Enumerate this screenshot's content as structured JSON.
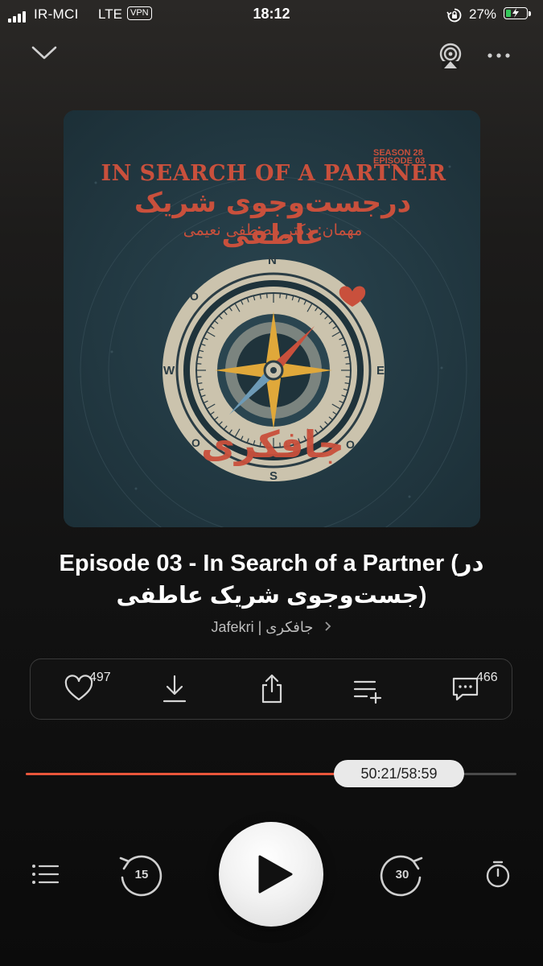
{
  "status_bar": {
    "carrier": "IR-MCI",
    "network": "LTE",
    "vpn": "VPN",
    "time": "18:12",
    "battery_percent": "27%",
    "battery_level": 0.27
  },
  "top_bar": {
    "collapse_icon": "chevron-down-icon",
    "airplay_icon": "airplay-icon",
    "more_icon": "more-horizontal-icon"
  },
  "artwork": {
    "season": "SEASON 28",
    "episode": "EPISODE 03",
    "headline": "IN SEARCH OF A PARTNER",
    "persian_title": "درجست‌وجوی شریک عاطفی",
    "guest": "مهمان: دکتر مصطفی نعیمی",
    "brand": "جافکری",
    "compass": {
      "n": "N",
      "s": "S",
      "e": "E",
      "w": "W",
      "o": "O"
    },
    "colors": {
      "background": "#21363f",
      "accent": "#c9503c",
      "dial": "#cbc3ad"
    }
  },
  "episode": {
    "title": "Episode 03 - In Search of a Partner (در جست‌وجوی شریک عاطفی)",
    "podcast": "Jafekri | جافکری"
  },
  "actions": {
    "like_count": "497",
    "comment_count": "466",
    "icons": [
      "heart-icon",
      "download-icon",
      "share-icon",
      "add-to-queue-icon",
      "comment-icon"
    ]
  },
  "progress": {
    "elapsed_total": "50:21/58:59",
    "fraction": 0.853,
    "played_color": "#e8553a"
  },
  "controls": {
    "rewind_seconds": "15",
    "forward_seconds": "30",
    "play_icon": "play-icon",
    "queue_icon": "queue-list-icon",
    "timer_icon": "sleep-timer-icon"
  }
}
